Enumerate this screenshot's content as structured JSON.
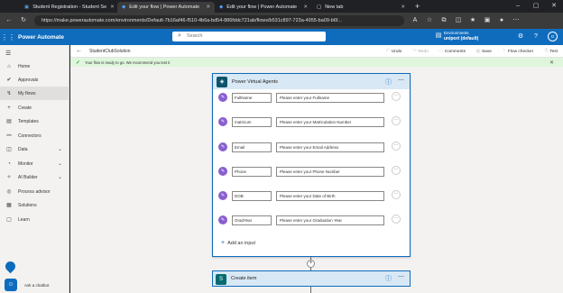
{
  "browser": {
    "tabs": [
      {
        "label": "Student Registration - Student Se"
      },
      {
        "label": "Edit your flow | Power Automate"
      },
      {
        "label": "Edit your flow | Power Automate"
      },
      {
        "label": "New tab"
      }
    ],
    "url": "https://make.powerautomate.com/environments/Default-7b16af46-f510-4b6a-bd54-886fddc721ab/flows/b531c897-723a-4955-ba09-b6f..."
  },
  "app": {
    "name": "Power Automate",
    "search_placeholder": "Search",
    "env_label": "Environments",
    "env_value": "uniport (default)",
    "avatar": "O"
  },
  "sidebar": {
    "items": [
      {
        "label": "Home",
        "icon": "home-icon",
        "glyph": "⌂"
      },
      {
        "label": "Approvals",
        "icon": "approvals-icon",
        "glyph": "✔"
      },
      {
        "label": "My flows",
        "icon": "flows-icon",
        "glyph": "↯"
      },
      {
        "label": "Create",
        "icon": "plus-icon",
        "glyph": "+"
      },
      {
        "label": "Templates",
        "icon": "templates-icon",
        "glyph": "▤"
      },
      {
        "label": "Connectors",
        "icon": "connectors-icon",
        "glyph": "⚯"
      },
      {
        "label": "Data",
        "icon": "data-icon",
        "glyph": "◫"
      },
      {
        "label": "Monitor",
        "icon": "monitor-icon",
        "glyph": "◔"
      },
      {
        "label": "AI Builder",
        "icon": "ai-builder-icon",
        "glyph": "✧"
      },
      {
        "label": "Process advisor",
        "icon": "process-advisor-icon",
        "glyph": "◎"
      },
      {
        "label": "Solutions",
        "icon": "solutions-icon",
        "glyph": "▦"
      },
      {
        "label": "Learn",
        "icon": "learn-icon",
        "glyph": "▢"
      }
    ],
    "chatbot_label": "Ask a chatbot"
  },
  "commandbar": {
    "flow_name": "StudentClubSolution",
    "undo": "Undo",
    "redo": "Redo",
    "comments": "Comments",
    "save": "Save",
    "flow_checker": "Flow checker",
    "test": "Test"
  },
  "banner": {
    "text": "Your flow is ready to go. We recommend you test it"
  },
  "trigger": {
    "title": "Power Virtual Agents",
    "inputs": [
      {
        "name": "FullName",
        "prompt": "Please enter your Fullname"
      },
      {
        "name": "matricum",
        "prompt": "Please enter your Matriculation Number"
      },
      {
        "name": "Email",
        "prompt": "Please enter your Email Address"
      },
      {
        "name": "Phone",
        "prompt": "Please enter your Phone Number"
      },
      {
        "name": "DOB",
        "prompt": "Please enter your Date of Birth"
      },
      {
        "name": "GradYear",
        "prompt": "Please enter your Graduation Year"
      }
    ],
    "add_input": "Add an input"
  },
  "action": {
    "title": "Create item",
    "icon_letter": "S"
  },
  "colors": {
    "brand": "#0f6cbd",
    "card_header": "#d8e8f5",
    "input_icon": "#8a5fd0",
    "banner": "#dff6dd"
  }
}
